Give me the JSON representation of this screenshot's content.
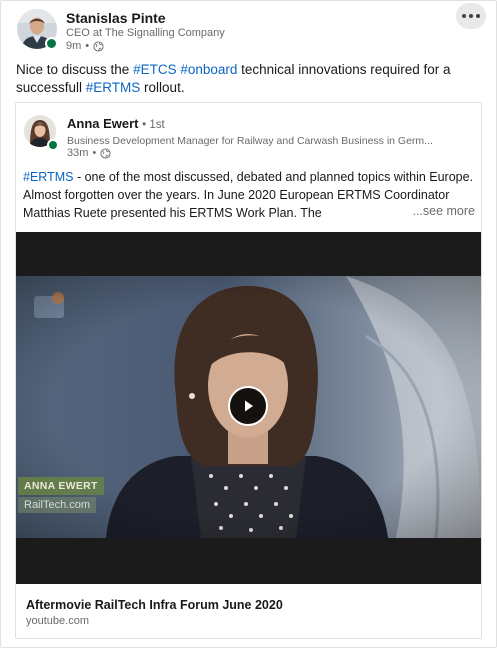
{
  "post": {
    "author": {
      "name": "Stanislas Pinte",
      "headline": "CEO at The Signalling Company",
      "time": "9m",
      "visibility_icon": "globe-icon"
    },
    "more_icon": "ellipsis-icon",
    "text": {
      "part1": "Nice to discuss the ",
      "tag1": "#ETCS",
      "space1": " ",
      "tag2": "#onboard",
      "part2": " technical innovations required for a successfull ",
      "tag3": "#ERTMS",
      "part3": " rollout."
    }
  },
  "shared_post": {
    "author": {
      "name": "Anna Ewert",
      "degree": "• 1st",
      "headline": "Business Development Manager for Railway and Carwash Business in Germ...",
      "time": "33m",
      "visibility_icon": "globe-icon"
    },
    "text": {
      "tag": "#ERTMS",
      "body": " - one of the most discussed, debated and planned topics within Europe. Almost forgotten over the years. In June 2020 European ERTMS Coordinator Matthias Ruete presented his ERTMS Work Plan. The",
      "see_more": "...see more"
    },
    "video": {
      "overlay_name": "ANNA EWERT",
      "overlay_brand": "RailTech.com",
      "play_icon": "play-icon"
    },
    "link": {
      "title": "Aftermovie RailTech Infra Forum June 2020",
      "domain": "youtube.com"
    }
  },
  "colors": {
    "hashtag": "#0a66c2",
    "presence": "#057642"
  }
}
